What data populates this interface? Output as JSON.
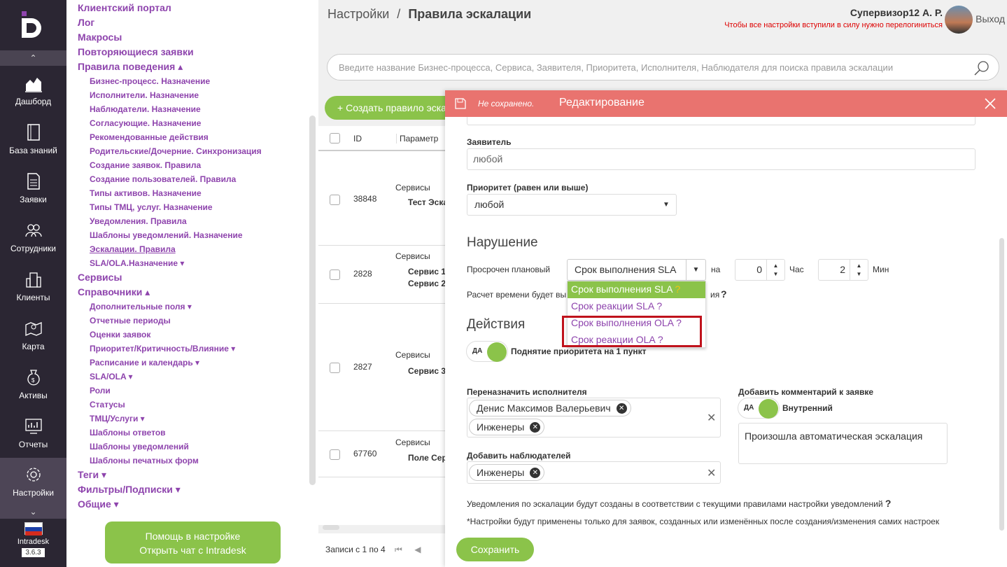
{
  "rail": {
    "items": [
      {
        "label": "Дашборд",
        "icon": "chart-icon"
      },
      {
        "label": "База знаний",
        "icon": "book-icon"
      },
      {
        "label": "Заявки",
        "icon": "document-icon"
      },
      {
        "label": "Сотрудники",
        "icon": "users-icon"
      },
      {
        "label": "Клиенты",
        "icon": "building-icon"
      },
      {
        "label": "Карта",
        "icon": "map-icon"
      },
      {
        "label": "Активы",
        "icon": "money-bag-icon"
      },
      {
        "label": "Отчеты",
        "icon": "report-icon"
      },
      {
        "label": "Настройки",
        "icon": "gear-icon"
      }
    ],
    "brand": "Intradesk",
    "version": "3.6.3"
  },
  "menu": {
    "top": [
      "Клиентский портал",
      "Лог",
      "Макросы",
      "Повторяющиеся заявки"
    ],
    "rules_header": "Правила поведения ▴",
    "rules": [
      "Бизнес-процесс. Назначение",
      "Исполнители. Назначение",
      "Наблюдатели. Назначение",
      "Согласующие. Назначение",
      "Рекомендованные действия",
      "Родительские/Дочерние. Синхронизация",
      "Создание заявок. Правила",
      "Создание пользователей. Правила",
      "Типы активов. Назначение",
      "Типы ТМЦ, услуг. Назначение",
      "Уведомления. Правила",
      "Шаблоны уведомлений. Назначение",
      "Эскалации. Правила",
      "SLA/OLA.Назначение ▾"
    ],
    "services": "Сервисы",
    "refs_header": "Справочники ▴",
    "refs": [
      "Дополнительные поля ▾",
      "Отчетные периоды",
      "Оценки заявок",
      "Приоритет/Критичность/Влияние ▾",
      "Расписание и календарь ▾",
      "SLA/OLA ▾",
      "Роли",
      "Статусы",
      "ТМЦ/Услуги ▾",
      "Шаблоны ответов",
      "Шаблоны уведомлений",
      "Шаблоны печатных форм"
    ],
    "bottom": [
      "Теги ▾",
      "Фильтры/Подписки ▾",
      "Общие ▾"
    ],
    "help_line1": "Помощь в настройке",
    "help_line2": "Открыть чат с Intradesk"
  },
  "header": {
    "crumb_root": "Настройки",
    "crumb_sep": "/",
    "crumb_current": "Правила эскалации",
    "user_name": "Супервизор12 А. Р.",
    "relogin_warning": "Чтобы все настройки вступили в силу нужно перелогиниться",
    "logout": "Выход",
    "search_placeholder": "Введите название Бизнес-процесса, Сервиса, Заявителя, Приоритета, Исполнителя, Наблюдателя для поиска правила эскалации"
  },
  "table": {
    "create_label": "Создать правило эскалации",
    "columns": [
      "ID",
      "Параметр"
    ],
    "rows": [
      {
        "id": "38848",
        "param": "Сервисы",
        "sub": "Тест Эскалации"
      },
      {
        "id": "2828",
        "param": "Сервисы",
        "sub": "Сервис 1",
        "sub2": "Сервис 2"
      },
      {
        "id": "2827",
        "param": "Сервисы",
        "sub": "Сервис 3"
      },
      {
        "id": "67760",
        "param": "Сервисы",
        "sub": "Поле Сервис"
      }
    ],
    "records": "Записи с 1 по 4"
  },
  "panel": {
    "unsaved": "Не сохранено.",
    "title": "Редактирование",
    "requester_label": "Заявитель",
    "requester_value": "любой",
    "priority_label": "Приоритет (равен или выше)",
    "priority_value": "любой",
    "violation_title": "Нарушение",
    "overdue_label": "Просрочен плановый",
    "overdue_value": "Срок выполнения SLA",
    "on_label": "на",
    "hours": "0",
    "hours_label": "Час",
    "minutes": "2",
    "minutes_label": "Мин",
    "calc_note_start": "Расчет времени будет вы",
    "calc_note_end": "ия",
    "dropdown_options": [
      {
        "label": "Срок выполнения SLA",
        "selected": true
      },
      {
        "label": "Срок реакции SLA",
        "selected": false
      },
      {
        "label": "Срок выполнения OLA",
        "selected": false
      },
      {
        "label": "Срок реакции OLA",
        "selected": false
      }
    ],
    "q_mark": "?",
    "actions_title": "Действия",
    "toggle_yes": "ДА",
    "raise_priority": "Поднятие приоритета на 1 пункт",
    "reassign_label": "Переназначить исполнителя",
    "assignees": [
      "Денис Максимов Валерьевич",
      "Инженеры"
    ],
    "add_comment_label": "Добавить комментарий к заявке",
    "internal_label": "Внутренний",
    "comment_text": "Произошла автоматическая эскалация",
    "watchers_label": "Добавить наблюдателей",
    "watchers": [
      "Инженеры"
    ],
    "notice1": "Уведомления по эскалации будут созданы в соответствии с текущими правилами настройки уведомлений",
    "notice2": "*Настройки будут применены только для заявок, созданных или изменённых после создания/изменения самих настроек",
    "save_label": "Сохранить"
  },
  "colors": {
    "accent": "#8bc34a",
    "menu_link": "#8e44ad",
    "header_red": "#e9736f",
    "rail": "#2b2633",
    "highlight": "#c0121c"
  }
}
